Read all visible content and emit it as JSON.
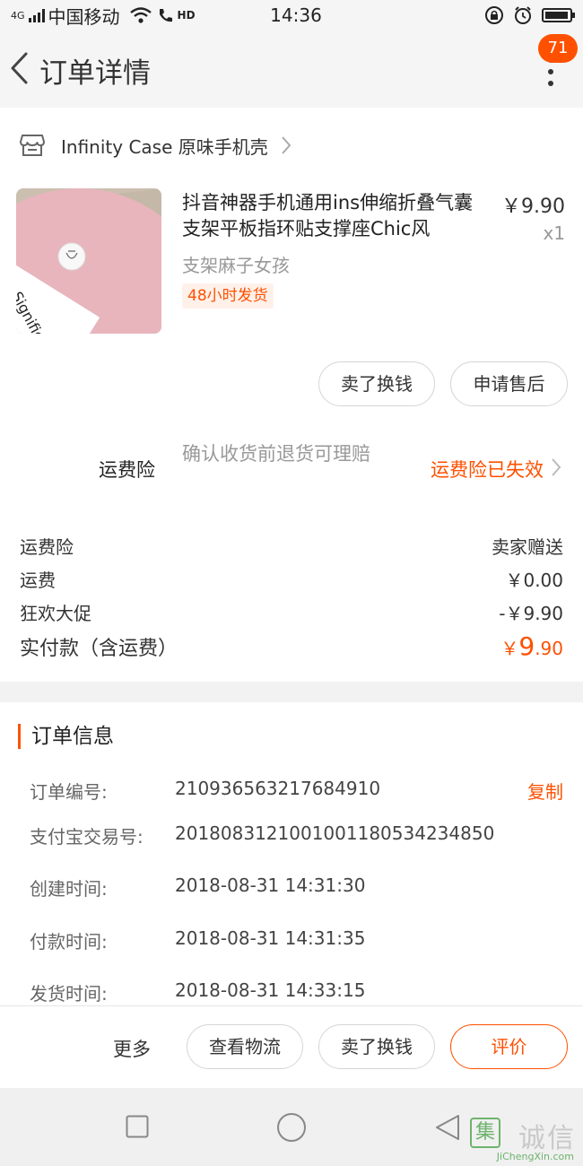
{
  "status_bar": {
    "network_type": "4G",
    "carrier": "中国移动",
    "hd_label": "HD",
    "time": "14:36"
  },
  "header": {
    "title": "订单详情",
    "badge_count": "71"
  },
  "shop": {
    "name": "Infinity Case 原味手机壳"
  },
  "product": {
    "title": "抖音神器手机通用ins伸缩折叠气囊支架平板指环贴支撑座Chic风",
    "price": "￥9.90",
    "quantity": "x1",
    "sku": "支架麻子女孩",
    "ship_tag": "48小时发货",
    "thumb_text": "Significant"
  },
  "item_buttons": {
    "sell": "卖了换钱",
    "after_sale": "申请售后"
  },
  "insurance": {
    "label": "运费险",
    "desc": "确认收货前退货可理赔",
    "status": "运费险已失效"
  },
  "summary": [
    {
      "label": "运费险",
      "value": "卖家赠送"
    },
    {
      "label": "运费",
      "value": "￥0.00"
    },
    {
      "label": "狂欢大促",
      "value": "-￥9.90"
    }
  ],
  "total": {
    "label": "实付款（含运费）",
    "currency": "￥",
    "int": "9",
    "dec": ".90"
  },
  "order_info": {
    "title": "订单信息",
    "copy_label": "复制",
    "rows": [
      {
        "key": "订单编号:",
        "value": "210936563217684910"
      },
      {
        "key": "支付宝交易号:",
        "value": "2018083121001001180534234850"
      },
      {
        "key": "创建时间:",
        "value": "2018-08-31 14:31:30"
      },
      {
        "key": "付款时间:",
        "value": "2018-08-31 14:31:35"
      },
      {
        "key": "发货时间:",
        "value": "2018-08-31 14:33:15"
      }
    ]
  },
  "actions": {
    "more": "更多",
    "logistics": "查看物流",
    "sell": "卖了换钱",
    "review": "评价"
  },
  "watermark": {
    "glyph": "集",
    "cn": "诚信",
    "en": "JiChengXin.com"
  },
  "colors": {
    "accent": "#ff5000",
    "muted": "#999999"
  }
}
